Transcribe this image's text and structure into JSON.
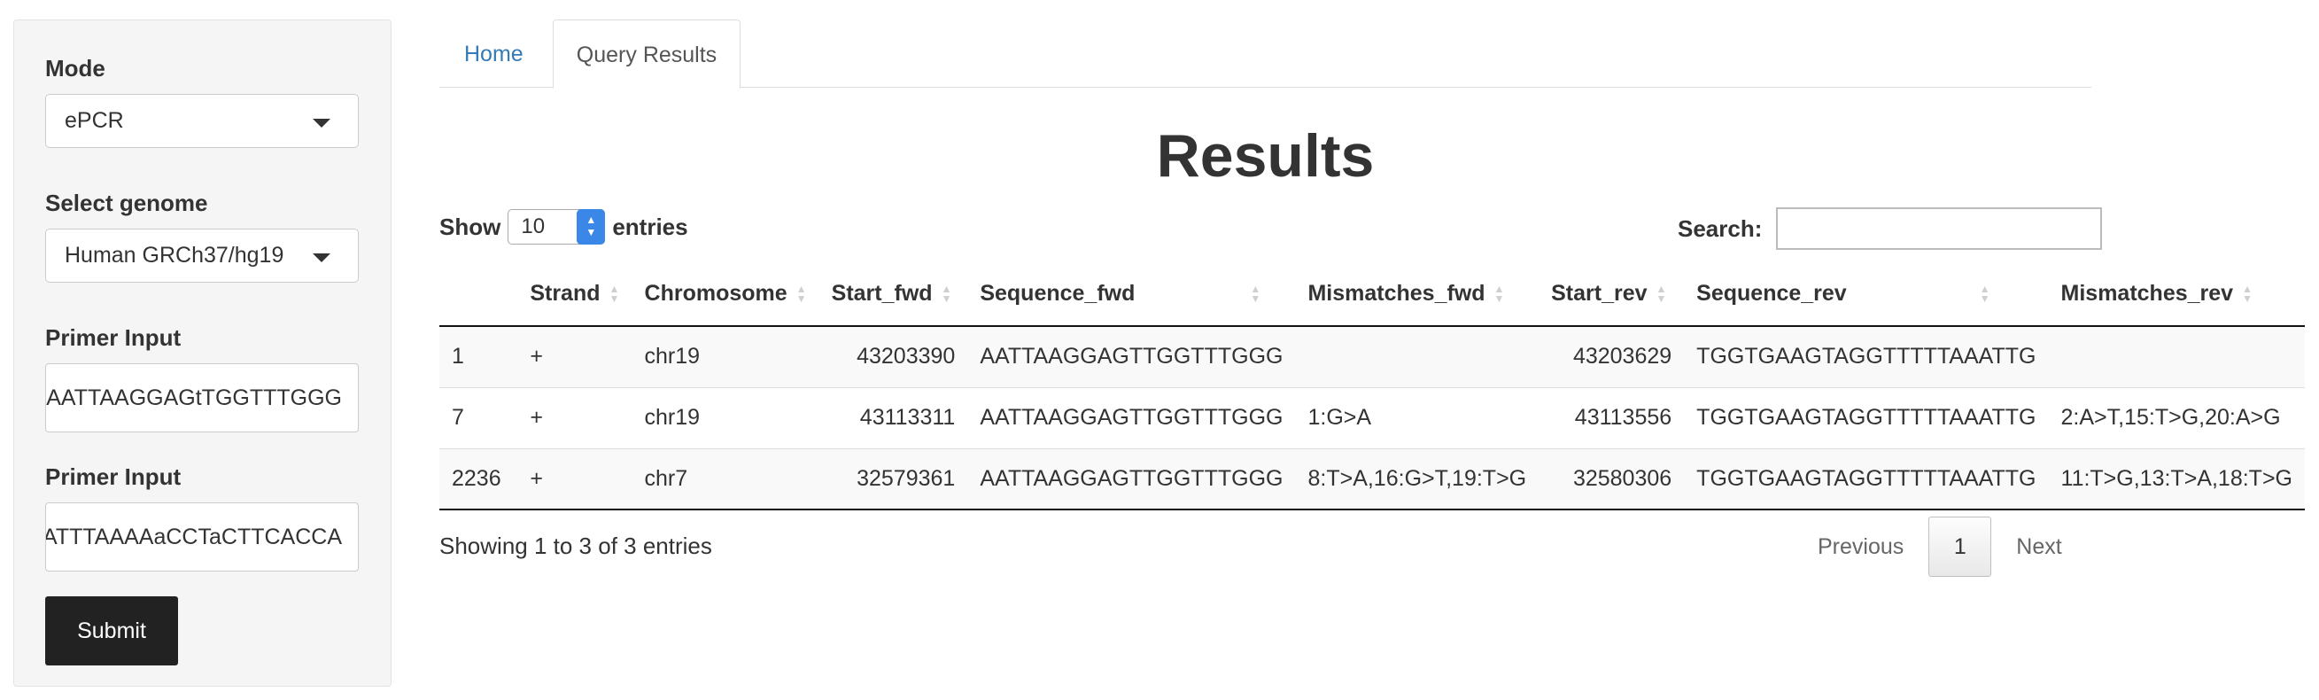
{
  "sidebar": {
    "mode_label": "Mode",
    "mode_value": "ePCR",
    "genome_label": "Select genome",
    "genome_value": "Human GRCh37/hg19",
    "primer_fwd_label": "Primer Input",
    "primer_fwd_value": "AATTAAGGAGtTGGTTTGGG",
    "primer_rev_label": "Primer Input",
    "primer_rev_value": "CAATTTAAAAaCCTaCTTCACCA",
    "submit_label": "Submit"
  },
  "tabs": [
    {
      "label": "Home",
      "active": false
    },
    {
      "label": "Query Results",
      "active": true
    }
  ],
  "main": {
    "title": "Results",
    "show_label": "Show",
    "entries_label": "entries",
    "page_length": "10",
    "search_label": "Search:",
    "search_value": "",
    "info": "Showing 1 to 3 of 3 entries",
    "pagination": {
      "previous": "Previous",
      "current": "1",
      "next": "Next"
    }
  },
  "table": {
    "columns": [
      "",
      "Strand",
      "Chromosome",
      "Start_fwd",
      "Sequence_fwd",
      "Mismatches_fwd",
      "Start_rev",
      "Sequence_rev",
      "Mismatches_rev"
    ],
    "rows": [
      [
        "1",
        "+",
        "chr19",
        "43203390",
        "AATTAAGGAGTTGGTTTGGG",
        "",
        "43203629",
        "TGGTGAAGTAGGTTTTTAAATTG",
        ""
      ],
      [
        "7",
        "+",
        "chr19",
        "43113311",
        "AATTAAGGAGTTGGTTTGGG",
        "1:G>A",
        "43113556",
        "TGGTGAAGTAGGTTTTTAAATTG",
        "2:A>T,15:T>G,20:A>G"
      ],
      [
        "2236",
        "+",
        "chr7",
        "32579361",
        "AATTAAGGAGTTGGTTTGGG",
        "8:T>A,16:G>T,19:T>G",
        "32580306",
        "TGGTGAAGTAGGTTTTTAAATTG",
        "11:T>G,13:T>A,18:T>G"
      ]
    ]
  },
  "colors": {
    "link": "#337ab7",
    "submit_bg": "#222222",
    "spinner": "#3b87e8"
  }
}
